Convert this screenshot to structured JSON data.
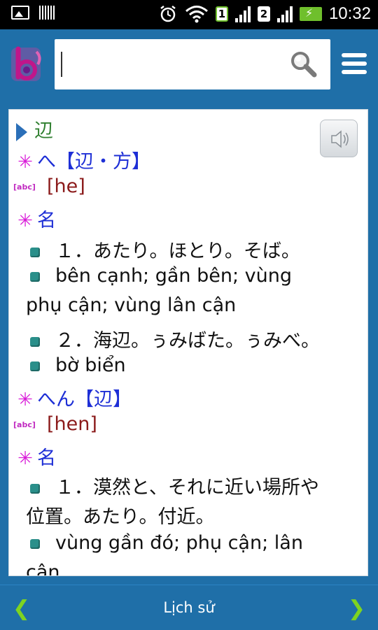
{
  "status": {
    "time": "10:32",
    "sim1": "1",
    "sim2": "2"
  },
  "search": {
    "value": "",
    "placeholder": ""
  },
  "entry": {
    "headword": "辺",
    "readings": [
      {
        "kana": "へ【辺・方】",
        "romaji": "[he]",
        "pos": "名",
        "senses": [
          "１．あたり。ほとり。そば。",
          "bên cạnh; gần bên; vùng",
          "phụ cận; vùng lân cận",
          "２．海辺。ぅみばた。ぅみべ。",
          "bờ biển"
        ]
      },
      {
        "kana": "へん【辺】",
        "romaji": "[hen]",
        "pos": "名",
        "senses": [
          "１．漠然と、それに近い場所や",
          "位置。あたり。付近。",
          "vùng gần đó; phụ cận; lân",
          "cận"
        ]
      }
    ]
  },
  "bottom": {
    "history_label": "Lịch sử",
    "prev": "❮",
    "next": "❯"
  },
  "colors": {
    "accent": "#1f6fa8",
    "headword": "#2f7f2f",
    "reading": "#1e2fd6",
    "romaji": "#8b1a1a",
    "star": "#d81bd8",
    "nav": "#7ed321"
  }
}
